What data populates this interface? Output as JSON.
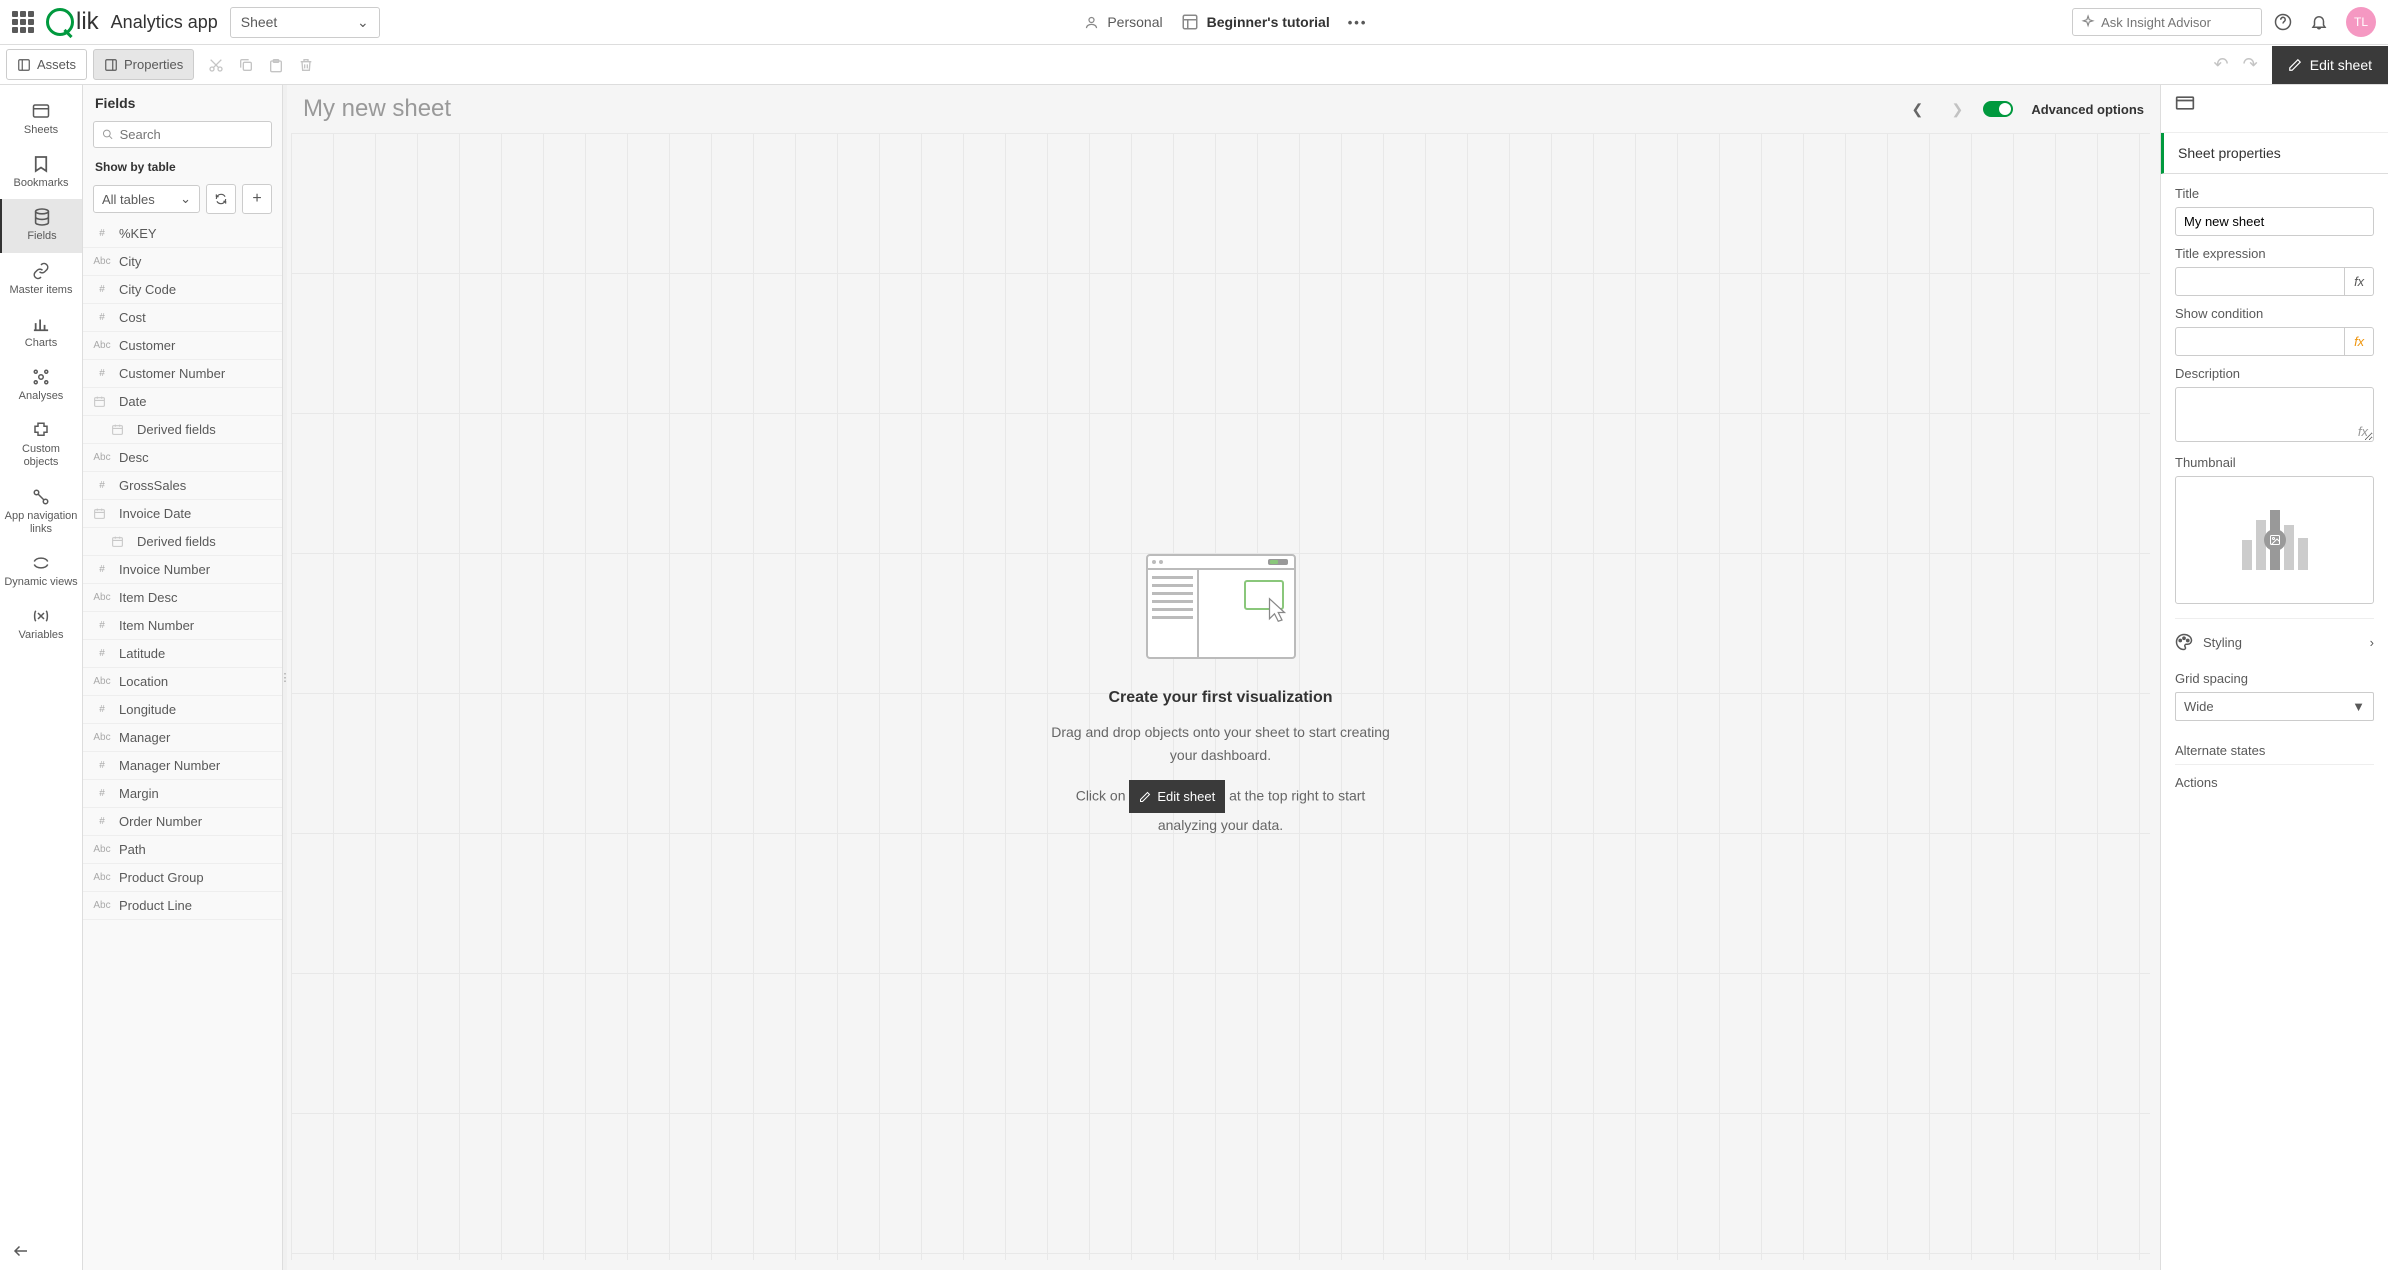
{
  "header": {
    "app_name": "Analytics app",
    "sheet_dropdown": "Sheet",
    "personal": "Personal",
    "tutorial": "Beginner's tutorial",
    "insight_placeholder": "Ask Insight Advisor",
    "avatar": "TL"
  },
  "toolbar": {
    "assets": "Assets",
    "properties": "Properties",
    "edit_sheet": "Edit sheet"
  },
  "left_nav": {
    "sheets": "Sheets",
    "bookmarks": "Bookmarks",
    "fields": "Fields",
    "master_items": "Master items",
    "charts": "Charts",
    "analyses": "Analyses",
    "custom_objects": "Custom objects",
    "app_nav": "App navigation links",
    "dynamic_views": "Dynamic views",
    "variables": "Variables"
  },
  "fields_panel": {
    "title": "Fields",
    "search_placeholder": "Search",
    "show_by": "Show by table",
    "all_tables": "All tables",
    "fields": [
      {
        "type": "#",
        "name": "%KEY"
      },
      {
        "type": "Abc",
        "name": "City"
      },
      {
        "type": "#",
        "name": "City Code"
      },
      {
        "type": "#",
        "name": "Cost"
      },
      {
        "type": "Abc",
        "name": "Customer"
      },
      {
        "type": "#",
        "name": "Customer Number"
      },
      {
        "type": "date",
        "name": "Date"
      },
      {
        "type": "derived",
        "name": "Derived fields"
      },
      {
        "type": "Abc",
        "name": "Desc"
      },
      {
        "type": "#",
        "name": "GrossSales"
      },
      {
        "type": "date",
        "name": "Invoice Date"
      },
      {
        "type": "derived",
        "name": "Derived fields"
      },
      {
        "type": "#",
        "name": "Invoice Number"
      },
      {
        "type": "Abc",
        "name": "Item Desc"
      },
      {
        "type": "#",
        "name": "Item Number"
      },
      {
        "type": "#",
        "name": "Latitude"
      },
      {
        "type": "Abc",
        "name": "Location"
      },
      {
        "type": "#",
        "name": "Longitude"
      },
      {
        "type": "Abc",
        "name": "Manager"
      },
      {
        "type": "#",
        "name": "Manager Number"
      },
      {
        "type": "#",
        "name": "Margin"
      },
      {
        "type": "#",
        "name": "Order Number"
      },
      {
        "type": "Abc",
        "name": "Path"
      },
      {
        "type": "Abc",
        "name": "Product Group"
      },
      {
        "type": "Abc",
        "name": "Product Line"
      }
    ]
  },
  "canvas": {
    "sheet_title": "My new sheet",
    "advanced": "Advanced options",
    "empty_title": "Create your first visualization",
    "empty_text1": "Drag and drop objects onto your sheet to start creating your dashboard.",
    "empty_click": "Click on",
    "empty_btn": "Edit sheet",
    "empty_after": "at the top right to start analyzing your data."
  },
  "props": {
    "header": "Sheet properties",
    "title_label": "Title",
    "title_value": "My new sheet",
    "title_expr": "Title expression",
    "show_cond": "Show condition",
    "description": "Description",
    "thumbnail": "Thumbnail",
    "styling": "Styling",
    "grid_spacing": "Grid spacing",
    "grid_value": "Wide",
    "alternate": "Alternate states",
    "actions": "Actions"
  }
}
